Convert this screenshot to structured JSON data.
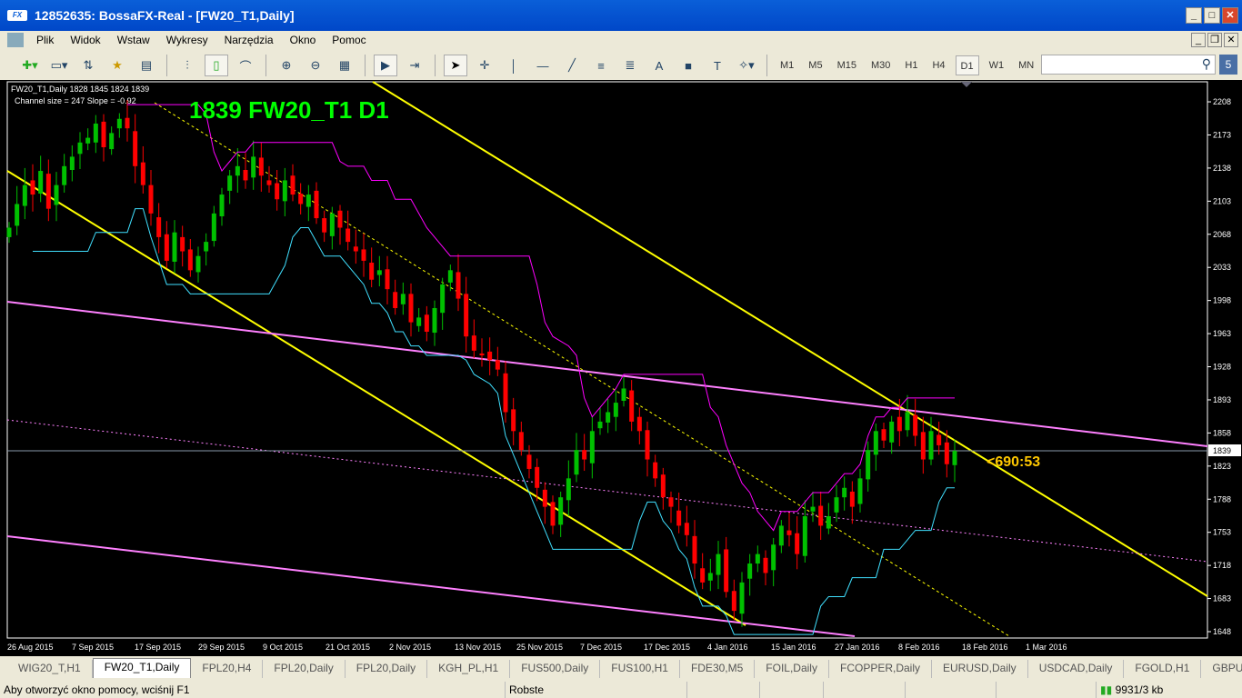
{
  "window": {
    "title": "12852635: BossaFX-Real - [FW20_T1,Daily]",
    "logo": "FX"
  },
  "menu": [
    "Plik",
    "Widok",
    "Wstaw",
    "Wykresy",
    "Narzędzia",
    "Okno",
    "Pomoc"
  ],
  "timeframes": [
    "M1",
    "M5",
    "M15",
    "M30",
    "H1",
    "H4",
    "D1",
    "W1",
    "MN"
  ],
  "active_timeframe": "D1",
  "search": {
    "value": "",
    "badge": "5"
  },
  "chart": {
    "info": "FW20_T1,Daily  1828 1845 1824 1839",
    "channel": "Channel size = 247 Slope = -0.92",
    "big_label": "1839 FW20_T1 D1",
    "annotation": "<690:53",
    "current_price": "1839",
    "price_ticks": [
      2208,
      2173,
      2138,
      2103,
      2068,
      2033,
      1998,
      1963,
      1928,
      1893,
      1858,
      1823,
      1788,
      1753,
      1718,
      1683,
      1648
    ],
    "date_ticks": [
      "26 Aug 2015",
      "7 Sep 2015",
      "17 Sep 2015",
      "29 Sep 2015",
      "9 Oct 2015",
      "21 Oct 2015",
      "2 Nov 2015",
      "13 Nov 2015",
      "25 Nov 2015",
      "7 Dec 2015",
      "17 Dec 2015",
      "4 Jan 2016",
      "15 Jan 2016",
      "27 Jan 2016",
      "8 Feb 2016",
      "18 Feb 2016",
      "1 Mar 2016"
    ],
    "colors": {
      "up": "#00c000",
      "down": "#ff0000",
      "channel": "#ffff00",
      "pink": "#ff80ff",
      "cyan": "#40e0ff",
      "magenta": "#ff00ff"
    },
    "closes": [
      2075,
      2100,
      2120,
      2110,
      2135,
      2095,
      2120,
      2140,
      2150,
      2165,
      2170,
      2185,
      2160,
      2175,
      2190,
      2180,
      2140,
      2120,
      2090,
      2065,
      2040,
      2070,
      2050,
      2030,
      2045,
      2060,
      2090,
      2110,
      2130,
      2140,
      2125,
      2150,
      2130,
      2120,
      2105,
      2125,
      2110,
      2100,
      2110,
      2085,
      2070,
      2090,
      2075,
      2060,
      2050,
      2040,
      2020,
      2030,
      2010,
      1990,
      2005,
      1975,
      1980,
      1965,
      1990,
      2015,
      2030,
      2000,
      1960,
      1945,
      1940,
      1935,
      1925,
      1880,
      1860,
      1840,
      1820,
      1800,
      1780,
      1760,
      1790,
      1810,
      1840,
      1830,
      1860,
      1870,
      1880,
      1890,
      1905,
      1870,
      1860,
      1830,
      1810,
      1790,
      1780,
      1760,
      1750,
      1720,
      1700,
      1710,
      1730,
      1690,
      1670,
      1700,
      1720,
      1730,
      1710,
      1740,
      1760,
      1750,
      1730,
      1770,
      1780,
      1760,
      1770,
      1790,
      1800,
      1780,
      1810,
      1840,
      1860,
      1850,
      1870,
      1860,
      1880,
      1855,
      1830,
      1860,
      1845,
      1825,
      1839
    ]
  },
  "tabs": [
    "WIG20_T,H1",
    "FW20_T1,Daily",
    "FPL20,H4",
    "FPL20,Daily",
    "FPL20,Daily",
    "KGH_PL,H1",
    "FUS500,Daily",
    "FUS100,H1",
    "FDE30,M5",
    "FOIL,Daily",
    "FCOPPER,Daily",
    "EURUSD,Daily",
    "USDCAD,Daily",
    "FGOLD,H1",
    "GBPUSD,D"
  ],
  "active_tab": 1,
  "status": {
    "help": "Aby otworzyć okno pomocy, wciśnij F1",
    "profile": "Robste",
    "traffic": "9931/3 kb"
  }
}
